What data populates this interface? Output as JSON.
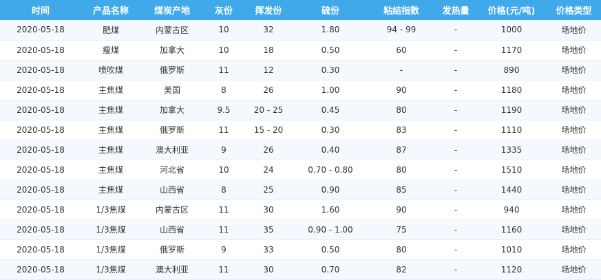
{
  "table": {
    "headers": [
      "时间",
      "产品名称",
      "煤炭产地",
      "灰份",
      "挥发份",
      "硫份",
      "粘结指数",
      "发热量",
      "价格(元/吨)",
      "价格类型"
    ],
    "rows": [
      [
        "2020-05-18",
        "肥煤",
        "内蒙古区",
        "10",
        "32",
        "1.80",
        "94 - 99",
        "-",
        "1000",
        "场地价"
      ],
      [
        "2020-05-18",
        "瘦煤",
        "加拿大",
        "10",
        "18",
        "0.50",
        "60",
        "-",
        "1170",
        "场地价"
      ],
      [
        "2020-05-18",
        "喷吹煤",
        "俄罗斯",
        "11",
        "12",
        "0.30",
        "-",
        "-",
        "890",
        "场地价"
      ],
      [
        "2020-05-18",
        "主焦煤",
        "美国",
        "8",
        "26",
        "1.00",
        "90",
        "-",
        "1180",
        "场地价"
      ],
      [
        "2020-05-18",
        "主焦煤",
        "加拿大",
        "9.5",
        "20 - 25",
        "0.45",
        "80",
        "-",
        "1190",
        "场地价"
      ],
      [
        "2020-05-18",
        "主焦煤",
        "俄罗斯",
        "11",
        "15 - 20",
        "0.30",
        "83",
        "-",
        "1110",
        "场地价"
      ],
      [
        "2020-05-18",
        "主焦煤",
        "澳大利亚",
        "9",
        "26",
        "0.40",
        "87",
        "-",
        "1335",
        "场地价"
      ],
      [
        "2020-05-18",
        "主焦煤",
        "河北省",
        "10",
        "24",
        "0.70 - 0.80",
        "80",
        "-",
        "1510",
        "场地价"
      ],
      [
        "2020-05-18",
        "主焦煤",
        "山西省",
        "8",
        "25",
        "0.90",
        "85",
        "-",
        "1440",
        "场地价"
      ],
      [
        "2020-05-18",
        "1/3焦煤",
        "内蒙古区",
        "11",
        "30",
        "1.60",
        "90",
        "-",
        "940",
        "场地价"
      ],
      [
        "2020-05-18",
        "1/3焦煤",
        "山西省",
        "11",
        "35",
        "0.90 - 1.00",
        "75",
        "-",
        "1160",
        "场地价"
      ],
      [
        "2020-05-18",
        "1/3焦煤",
        "俄罗斯",
        "9",
        "33",
        "0.50",
        "80",
        "-",
        "1010",
        "场地价"
      ],
      [
        "2020-05-18",
        "1/3焦煤",
        "澳大利亚",
        "11",
        "30",
        "0.70",
        "82",
        "-",
        "1120",
        "场地价"
      ]
    ]
  },
  "colors": {
    "header_bg": "#40a9ea",
    "row_alt_bg": "#f3f9fd"
  }
}
